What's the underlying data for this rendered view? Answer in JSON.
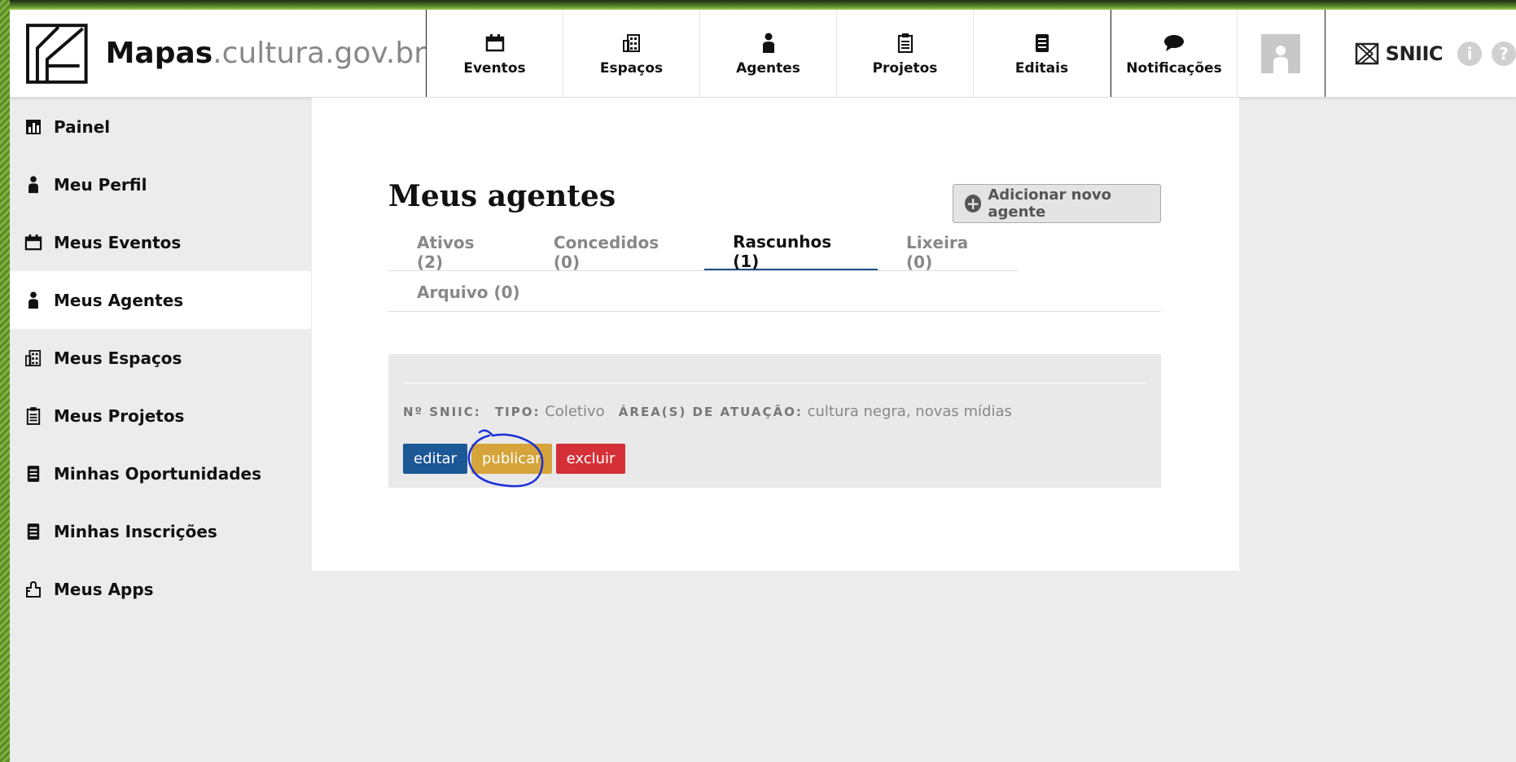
{
  "header": {
    "brand_name": "Mapas",
    "brand_domain": ".cultura.gov.br",
    "nav": [
      {
        "label": "Eventos",
        "icon": "calendar-icon"
      },
      {
        "label": "Espaços",
        "icon": "building-icon"
      },
      {
        "label": "Agentes",
        "icon": "person-icon"
      },
      {
        "label": "Projetos",
        "icon": "clipboard-icon"
      },
      {
        "label": "Editais",
        "icon": "document-icon"
      }
    ],
    "notifications_label": "Notificações",
    "sniic_label": "SNIIC",
    "info_glyph": "i",
    "help_glyph": "?"
  },
  "sidebar": {
    "items": [
      {
        "label": "Painel",
        "icon": "chart-icon"
      },
      {
        "label": "Meu Perfil",
        "icon": "person-icon"
      },
      {
        "label": "Meus Eventos",
        "icon": "calendar-icon"
      },
      {
        "label": "Meus Agentes",
        "icon": "person-icon",
        "active": true
      },
      {
        "label": "Meus Espaços",
        "icon": "building-icon"
      },
      {
        "label": "Meus Projetos",
        "icon": "clipboard-icon"
      },
      {
        "label": "Minhas Oportunidades",
        "icon": "document-icon"
      },
      {
        "label": "Minhas Inscrições",
        "icon": "document-icon"
      },
      {
        "label": "Meus Apps",
        "icon": "puzzle-icon"
      }
    ]
  },
  "main": {
    "title": "Meus agentes",
    "add_button": "Adicionar novo agente",
    "tabs": [
      {
        "label": "Ativos (2)"
      },
      {
        "label": "Concedidos (0)"
      },
      {
        "label": "Rascunhos (1)",
        "active": true
      },
      {
        "label": "Lixeira (0)"
      },
      {
        "label": "Arquivo (0)"
      }
    ],
    "agent": {
      "sniic_label": "Nº SNIIC:",
      "tipo_label": "TIPO:",
      "tipo_value": "Coletivo",
      "areas_label": "ÁREA(S) DE ATUAÇÃO:",
      "areas_value": "cultura negra, novas mídias",
      "actions": {
        "edit": "editar",
        "publish": "publicar",
        "delete": "excluir"
      }
    }
  },
  "colors": {
    "edit": "#1c5796",
    "publish": "#d5a43a",
    "delete": "#d53037",
    "annotation": "#1a2fd6"
  }
}
